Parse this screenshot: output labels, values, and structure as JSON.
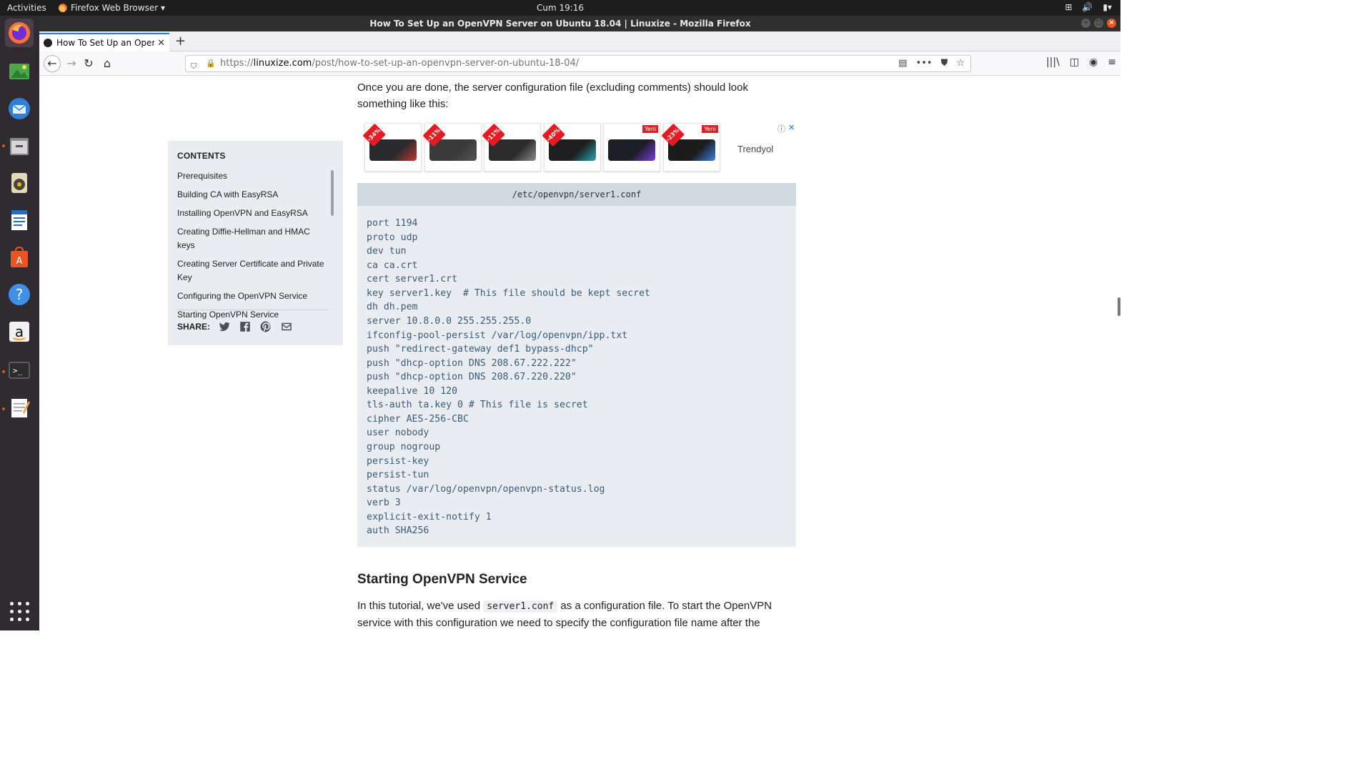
{
  "system_bar": {
    "activities": "Activities",
    "app_menu": "Firefox Web Browser ▾",
    "clock": "Cum 19:16"
  },
  "window": {
    "title": "How To Set Up an OpenVPN Server on Ubuntu 18.04 | Linuxize - Mozilla Firefox"
  },
  "dock": {
    "items": [
      "firefox-icon",
      "photos-icon",
      "thunderbird-icon",
      "files-icon",
      "rhythmbox-icon",
      "libreoffice-writer-icon",
      "ubuntu-software-icon",
      "help-icon",
      "amazon-icon",
      "terminal-icon",
      "text-editor-icon"
    ],
    "show_apps": "show-applications-icon"
  },
  "browser": {
    "tab_title": "How To Set Up an OpenVPN",
    "url_prefix": "https://",
    "url_domain": "linuxize.com",
    "url_path": "/post/how-to-set-up-an-openvpn-server-on-ubuntu-18-04/"
  },
  "article": {
    "intro": "Once you are done, the server configuration file (excluding comments) should look something like this:",
    "code_filename": "/etc/openvpn/server1.conf",
    "code": "port 1194\nproto udp\ndev tun\nca ca.crt\ncert server1.crt\nkey server1.key  # This file should be kept secret\ndh dh.pem\nserver 10.8.0.0 255.255.255.0\nifconfig-pool-persist /var/log/openvpn/ipp.txt\npush \"redirect-gateway def1 bypass-dhcp\"\npush \"dhcp-option DNS 208.67.222.222\"\npush \"dhcp-option DNS 208.67.220.220\"\nkeepalive 10 120\ntls-auth ta.key 0 # This file is secret\ncipher AES-256-CBC\nuser nobody\ngroup nogroup\npersist-key\npersist-tun\nstatus /var/log/openvpn/openvpn-status.log\nverb 3\nexplicit-exit-notify 1\nauth SHA256",
    "section_heading": "Starting OpenVPN Service",
    "body_pre": "In this tutorial, we've used ",
    "body_code": "server1.conf",
    "body_post": " as a configuration file. To start the OpenVPN service with this configuration we need to specify the configuration file name after the"
  },
  "toc": {
    "heading": "CONTENTS",
    "items": [
      "Prerequisites",
      "Building CA with EasyRSA",
      "Installing OpenVPN and EasyRSA",
      "Creating Diffie-Hellman and HMAC keys",
      "Creating Server Certificate and Private Key",
      "Configuring the OpenVPN Service",
      "Starting OpenVPN Service"
    ],
    "share_label": "SHARE:"
  },
  "ad": {
    "brand": "Trendyol",
    "items": [
      {
        "badge": "-34%",
        "new": "",
        "color": "#2a2a2e",
        "accent": "#c0392b"
      },
      {
        "badge": "-11%",
        "new": "",
        "color": "#3a3a3a",
        "accent": "#555555"
      },
      {
        "badge": "-11%",
        "new": "",
        "color": "#2b2b2b",
        "accent": "#8a8a8a"
      },
      {
        "badge": "-40%",
        "new": "",
        "color": "#1f1f1f",
        "accent": "#2aa7b8"
      },
      {
        "badge": "",
        "new": "Yeni",
        "color": "#1e1e28",
        "accent": "#7b3fe4"
      },
      {
        "badge": "-23%",
        "new": "Yeni",
        "color": "#1c1c1c",
        "accent": "#3f7fe0"
      }
    ]
  },
  "colors": {
    "code_text": "#3a5a78",
    "toc_bg": "#e9edf1",
    "accent_orange": "#e95420"
  }
}
